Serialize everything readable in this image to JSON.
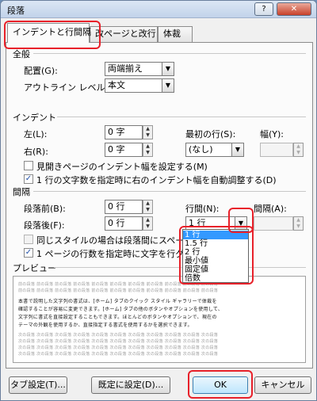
{
  "window": {
    "title": "段落",
    "help_label": "?",
    "close_label": "✕"
  },
  "tabs": [
    {
      "label": "インデントと行間隔"
    },
    {
      "label": "改ページと改行"
    },
    {
      "label": "体裁"
    }
  ],
  "general": {
    "section": "全般",
    "alignment_label": "配置(G):",
    "alignment_value": "両端揃え",
    "outline_label": "アウトライン レベル(O):",
    "outline_value": "本文"
  },
  "indent": {
    "section": "インデント",
    "left_label": "左(L):",
    "left_value": "0 字",
    "right_label": "右(R):",
    "right_value": "0 字",
    "first_line_label": "最初の行(S):",
    "first_line_value": "(なし)",
    "width_label": "幅(Y):",
    "width_value": "",
    "mirror_label": "見開きページのインデント幅を設定する(M)",
    "auto_adjust_label": "1 行の文字数を指定時に右のインデント幅を自動調整する(D)"
  },
  "spacing": {
    "section": "間隔",
    "before_label": "段落前(B):",
    "before_value": "0 行",
    "after_label": "段落後(F):",
    "after_value": "0 行",
    "line_spacing_label": "行間(N):",
    "line_spacing_value": "1 行",
    "at_label": "間隔(A):",
    "at_value": "",
    "same_style_label": "同じスタイルの場合は段落間にスペースを追",
    "grid_label": "1 ページの行数を指定時に文字を行グリッド"
  },
  "line_spacing_options": [
    "1 行",
    "1.5 行",
    "2 行",
    "最小値",
    "固定値",
    "倍数"
  ],
  "preview": {
    "section": "プレビュー",
    "prev_text": "前の段落 前の段落 前の段落 前の段落 前の段落 前の段落 前の段落 前の段落 前の段落 前の段落 前の段落",
    "sample_1": "本書で説明した文字列の書式は、[ホーム] タブのクイック スタイル ギャラリーで体裁を",
    "sample_2": "確認することが容易に変更できます。[ホーム] タブの他のボタンやオプションを使用して、",
    "sample_3": "文字列に書式を直接設定することもできます。ほとんどのボタンやオプションで、現在の",
    "sample_4": "テーマの外観を使用するか、直接指定する書式を使用するかを選択できます。",
    "next_text": "次の段落 次の段落 次の段落 次の段落 次の段落 次の段落 次の段落 次の段落 次の段落 次の段落 次の段落"
  },
  "buttons": {
    "tabs": "タブ設定(T)...",
    "default": "既定に設定(D)...",
    "ok": "OK",
    "cancel": "キャンセル"
  },
  "colors": {
    "highlight": "#e8212a",
    "selection": "#3399ff"
  }
}
